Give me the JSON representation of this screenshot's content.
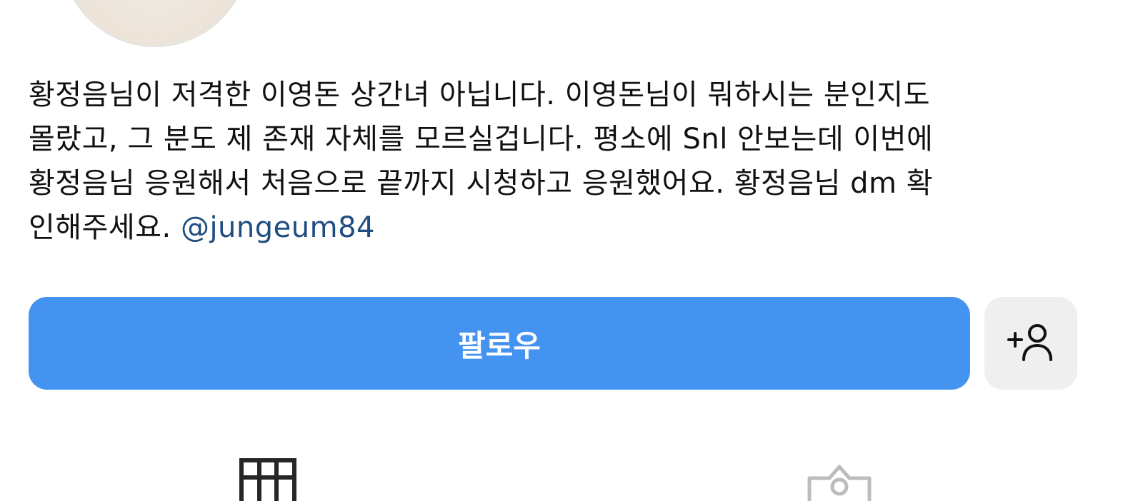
{
  "profile": {
    "bio_lines": [
      "황정음님이 저격한 이영돈 상간녀 아닙니다. 이영돈님이 뭐하시는 분인지도",
      "몰랐고, 그 분도 제 존재 자체를 모르실겁니다. 평소에 Snl 안보는데 이번에",
      "황정음님 응원해서 처음으로 끝까지 시청하고 응원했어요.  황정음님 dm 확"
    ],
    "bio_last_line": "인해주세요. ",
    "bio_mention": "@jungeum84"
  },
  "actions": {
    "follow_label": "팔로우",
    "suggest_icon": "add-person-icon"
  },
  "tabs": {
    "grid_icon": "grid-icon",
    "tagged_icon": "tagged-photo-icon"
  },
  "colors": {
    "follow_button": "#4493f1",
    "mention": "#1f4d80",
    "secondary_button": "#efefef"
  }
}
